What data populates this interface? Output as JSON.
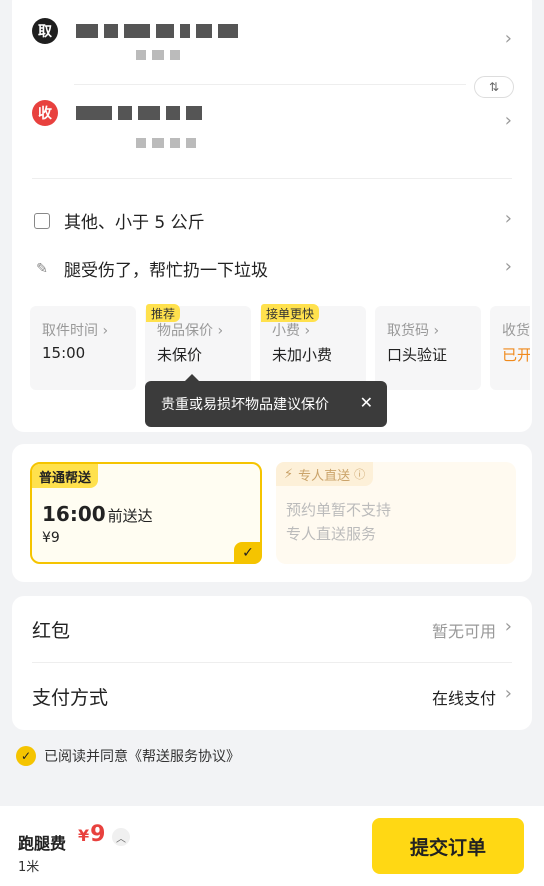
{
  "address": {
    "pickup_badge": "取",
    "receive_badge": "收",
    "swap_icon": "swap-vertical-icon"
  },
  "goods": {
    "item_type": "其他、小于 5 公斤",
    "remark": "腿受伤了，帮忙扔一下垃圾"
  },
  "tiles": [
    {
      "label": "取件时间 ›",
      "value": "15:00",
      "tag": ""
    },
    {
      "label": "物品保价 ›",
      "value": "未保价",
      "tag": "推荐"
    },
    {
      "label": "小费 ›",
      "value": "未加小费",
      "tag": "接单更快"
    },
    {
      "label": "取货码 ›",
      "value": "口头验证",
      "tag": ""
    },
    {
      "label": "收货",
      "value": "已开",
      "tag": ""
    }
  ],
  "tooltip": {
    "text": "贵重或易损坏物品建议保价",
    "close": "✕"
  },
  "delivery": {
    "normal": {
      "tag": "普通帮送",
      "time": "16:00",
      "time_suffix": "前送达",
      "price": "¥9",
      "selected": true
    },
    "direct": {
      "tag": "专人直送",
      "line1": "预约单暂不支持",
      "line2": "专人直送服务"
    }
  },
  "payment": {
    "redpacket_label": "红包",
    "redpacket_value": "暂无可用",
    "method_label": "支付方式",
    "method_value": "在线支付"
  },
  "agreement": {
    "text": "已阅读并同意《帮送服务协议》",
    "checked": true
  },
  "footer": {
    "fee_label": "跑腿费",
    "currency": "¥",
    "fee": "9",
    "distance": "1米",
    "submit": "提交订单"
  },
  "colors": {
    "accent": "#ffd814",
    "price_red": "#e8413e",
    "tip_orange": "#f08a1c"
  }
}
